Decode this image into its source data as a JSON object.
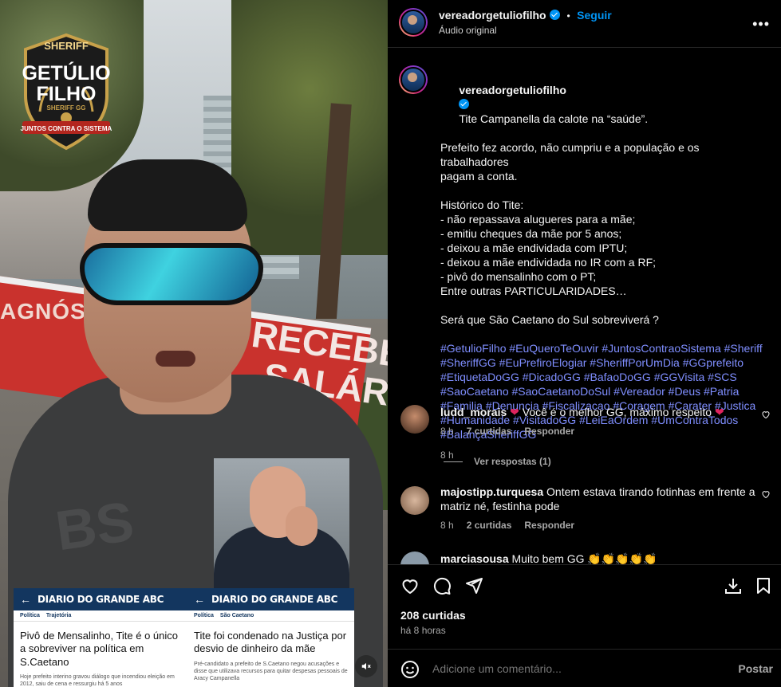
{
  "video": {
    "logo": {
      "top": "SHERIFF",
      "name_1": "GETÚLIO",
      "name_2": "FILHO",
      "sub": "SHERIFF GG",
      "tag": "JUNTOS CONTRA O SISTEMA",
      "color": "#c8a14a"
    },
    "banner": {
      "left": "AGNÓSTICO",
      "right_1": "RECEBE",
      "right_2": "SALÁR"
    },
    "shirt": "BS",
    "news_left": {
      "brand": "DIARIO DO GRANDE ABC",
      "crumb_1": "Política",
      "crumb_2": "Trajetória",
      "title": "Pivô de Mensalinho, Tite é o único a sobreviver na política em S.Caetano",
      "lead": "Hoje prefeito interino gravou diálogo que incendiou eleição em 2012, saiu de cena e ressurgiu há 5 anos"
    },
    "news_right": {
      "brand": "DIARIO DO GRANDE ABC",
      "crumb_1": "Política",
      "crumb_2": "São Caetano",
      "title": "Tite foi condenado na Justiça por desvio de dinheiro da mãe",
      "lead": "Pré-candidato a prefeito de S.Caetano negou acusações e disse que utilizava recursos para quitar despesas pessoais de Aracy Campanella"
    },
    "mute_icon": "speaker-muted-icon"
  },
  "header": {
    "username": "vereadorgetuliofilho",
    "separator": "•",
    "follow": "Seguir",
    "audio": "Áudio original",
    "more": "•••"
  },
  "caption": {
    "username": "vereadorgetuliofilho",
    "lines": [
      "Tite Campanella da calote na “saúde”.",
      "Prefeito fez acordo, não cumpriu e a população e os trabalhadores",
      "pagam a conta.",
      "",
      "Histórico do Tite:",
      "- não repassava alugueres para a mãe;",
      "- emitiu cheques da mãe por 5 anos;",
      "- deixou a mãe endividada com IPTU;",
      "- deixou a mãe endividada no IR com a RF;",
      "- pivô do mensalinho com o PT;",
      "Entre outras PARTICULARIDADES…",
      "",
      "Será que São Caetano do Sul sobreviverá ?",
      ""
    ],
    "hashtags": "#GetulioFilho #EuQueroTeOuvir #JuntosContraoSistema #Sheriff #SheriffGG #EuPrefiroElogiar #SheriffPorUmDia #GGprefeito #EtiquetaDoGG #DicadoGG #BafaoDoGG #GGVisita #SCS #SaoCaetano #SaoCaetanoDoSul #Vereador #Deus #Patria #Familia #Denuncia #Fiscalizacao #Coragem #Carater #Justica #Humanidade #VisitadoGG #LeiEaOrdem #UmContraTodos #BalançaSheriffGG",
    "time": "8 h"
  },
  "comments": [
    {
      "user": "ludd_morais",
      "text": "Você é o melhor GG, máximo respeito",
      "time": "8 h",
      "likes": "7 curtidas",
      "reply": "Responder"
    },
    {
      "user": "majostipp.turquesa",
      "text": "Ontem estava tirando fotinhas em frente a matriz né, festinha pode",
      "time": "8 h",
      "likes": "2 curtidas",
      "reply": "Responder"
    },
    {
      "user": "marciasousa",
      "text": "Muito bem GG 👏👏👏👏👏"
    }
  ],
  "view_replies": "Ver respostas (1)",
  "actions": {
    "likes": "208 curtidas",
    "time": "há 8 horas",
    "comment_placeholder": "Adicione um comentário...",
    "post": "Postar"
  }
}
